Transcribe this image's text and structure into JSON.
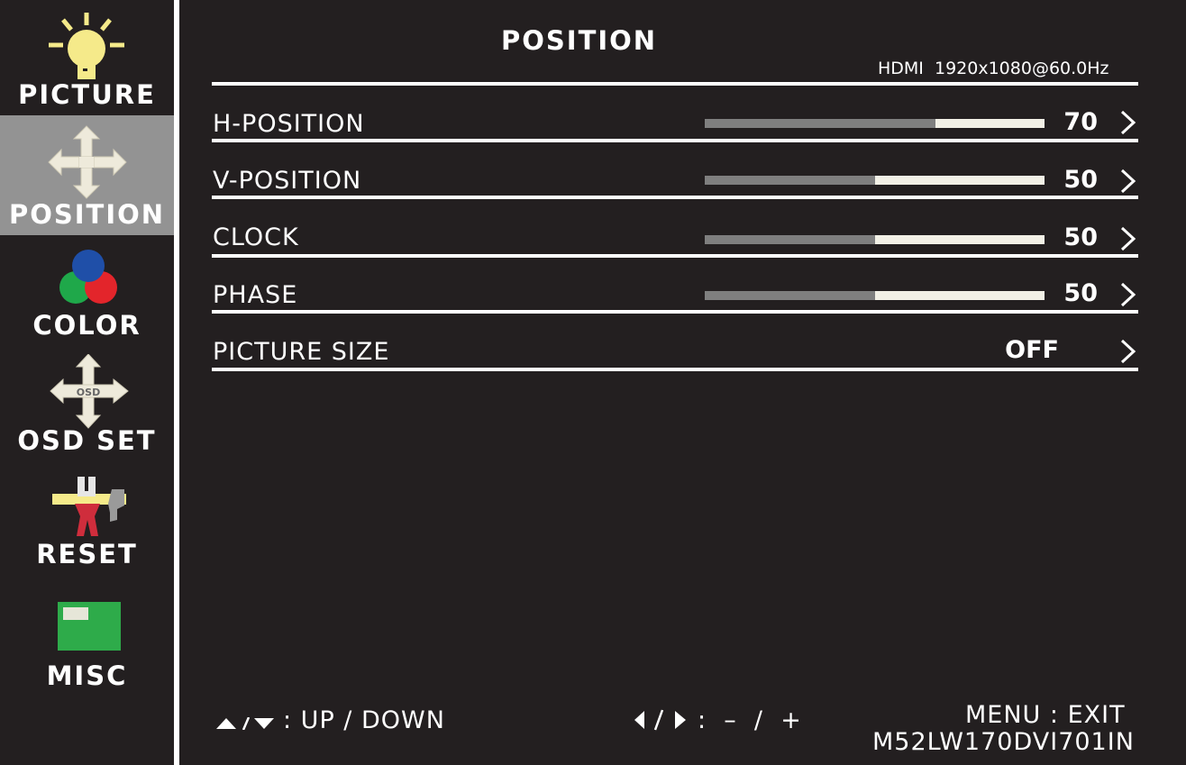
{
  "sidebar": {
    "items": [
      {
        "label": "PICTURE",
        "icon": "lightbulb-icon",
        "active": false
      },
      {
        "label": "POSITION",
        "icon": "move-arrows-icon",
        "active": true
      },
      {
        "label": "COLOR",
        "icon": "rgb-circles-icon",
        "active": false
      },
      {
        "label": "OSD SET",
        "icon": "osd-arrows-icon",
        "active": false
      },
      {
        "label": "RESET",
        "icon": "tools-icon",
        "active": false
      },
      {
        "label": "MISC",
        "icon": "misc-screen-icon",
        "active": false
      }
    ]
  },
  "header": {
    "title": "POSITION",
    "source": "HDMI  1920x1080@60.0Hz"
  },
  "settings": [
    {
      "label": "H-POSITION",
      "value": "70",
      "level": 0.68
    },
    {
      "label": "V-POSITION",
      "value": "50",
      "level": 0.5
    },
    {
      "label": "CLOCK",
      "value": "50",
      "level": 0.5
    },
    {
      "label": "PHASE",
      "value": "50",
      "level": 0.5
    },
    {
      "label": "PICTURE SIZE",
      "value": "OFF"
    }
  ],
  "footer": {
    "updown": ": UP / DOWN",
    "leftright": ":  –  /  +",
    "menu": "MENU : EXIT",
    "model": "M52LW170DVI701IN"
  },
  "colors": {
    "background": "#231f20",
    "active_tab": "#939393",
    "slider_fill": "#7f7f7f",
    "slider_track": "#f2f0e6"
  }
}
